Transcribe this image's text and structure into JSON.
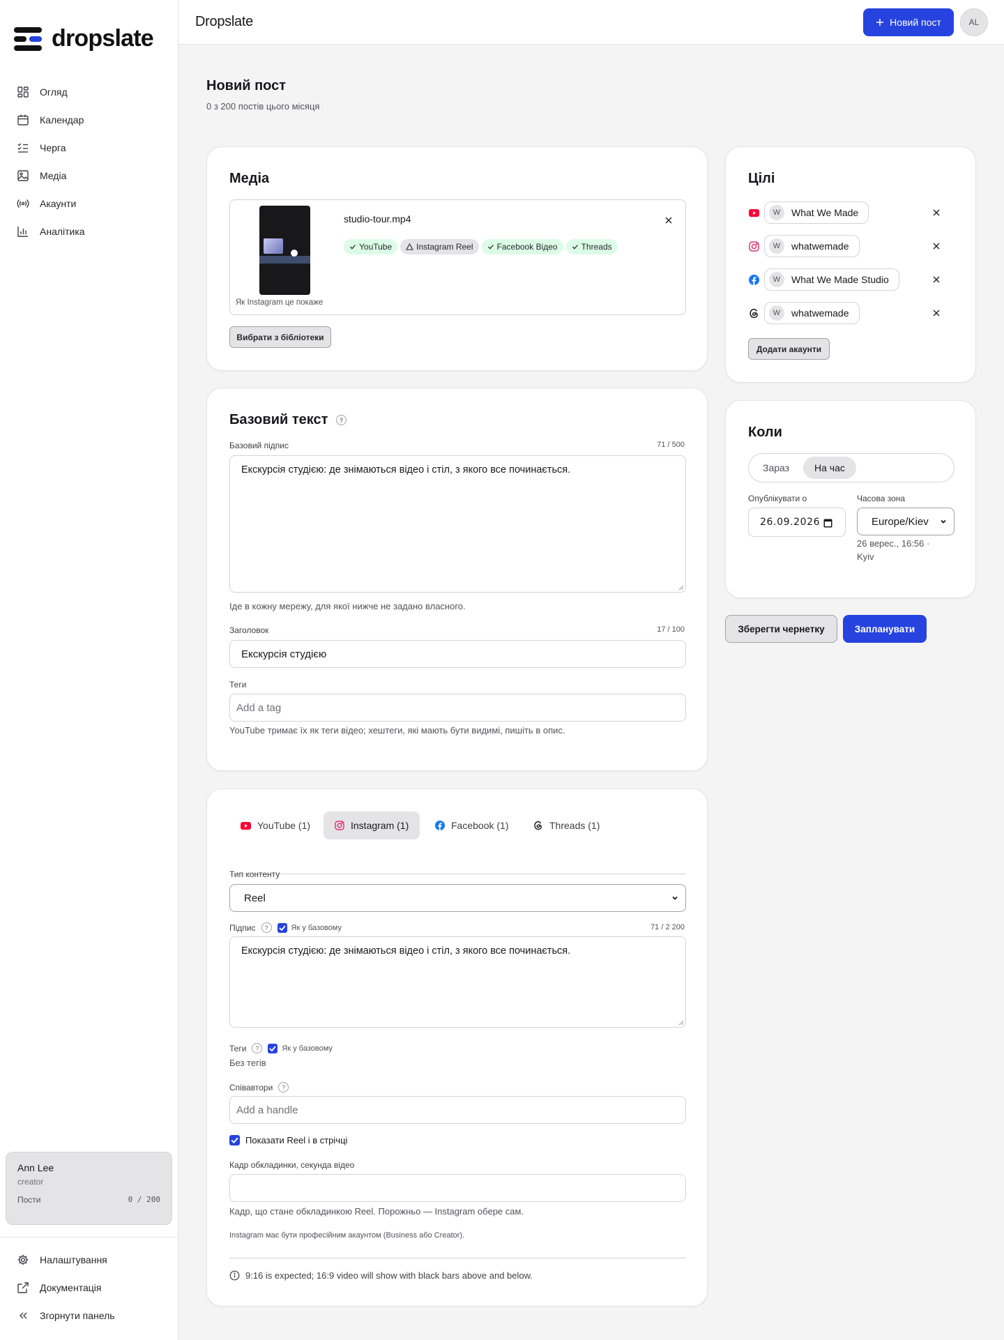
{
  "app": {
    "brand": "dropslate",
    "title": "Dropslate",
    "new_post_label": "Новий пост",
    "avatar_initials": "AL"
  },
  "sidebar": {
    "items": [
      {
        "label": "Огляд",
        "icon": "grid-icon"
      },
      {
        "label": "Календар",
        "icon": "calendar-icon"
      },
      {
        "label": "Черга",
        "icon": "list-check-icon"
      },
      {
        "label": "Медіа",
        "icon": "image-icon"
      },
      {
        "label": "Акаунти",
        "icon": "broadcast-icon"
      },
      {
        "label": "Аналітика",
        "icon": "bar-chart-icon"
      }
    ],
    "user": {
      "name": "Ann Lee",
      "role": "creator",
      "usage_label": "Пости",
      "usage_value": "0 / 200"
    },
    "bottom": [
      {
        "label": "Налаштування",
        "icon": "gear-icon"
      },
      {
        "label": "Документація",
        "icon": "external-link-icon"
      },
      {
        "label": "Згорнути панель",
        "icon": "chevrons-left-icon"
      }
    ]
  },
  "page": {
    "title": "Новий пост",
    "subtitle": "0 з 200 постів цього місяця"
  },
  "media": {
    "title": "Медіа",
    "filename": "studio-tour.mp4",
    "preview_caption": "Як Instagram це покаже",
    "platform_chips": [
      {
        "label": "YouTube",
        "status": "ok"
      },
      {
        "label": "Instagram Reel",
        "status": "warning"
      },
      {
        "label": "Facebook Відео",
        "status": "ok"
      },
      {
        "label": "Threads",
        "status": "ok"
      }
    ],
    "library_button": "Вибрати з бібліотеки"
  },
  "base_text": {
    "title": "Базовий текст",
    "help": "?",
    "caption_label": "Базовий підпис",
    "caption_counter": "71 / 500",
    "caption_value": "Екскурсія студією: де знімаються відео і стіл, з якого все починається.",
    "caption_hint": "Іде в кожну мережу, для якої нижче не задано власного.",
    "heading_label": "Заголовок",
    "heading_counter": "17 / 100",
    "heading_value": "Екскурсія студією",
    "tags_label": "Теги",
    "tags_placeholder": "Add a tag",
    "tags_hint": "YouTube тримає їх як теги відео; хештеги, які мають бути видимі, пишіть в опис."
  },
  "network": {
    "tabs": [
      {
        "label": "YouTube (1)",
        "icon": "youtube-icon",
        "active": false
      },
      {
        "label": "Instagram (1)",
        "icon": "instagram-icon",
        "active": true
      },
      {
        "label": "Facebook (1)",
        "icon": "facebook-icon",
        "active": false
      },
      {
        "label": "Threads (1)",
        "icon": "threads-icon",
        "active": false
      }
    ],
    "content_type_label": "Тип контенту",
    "content_type_value": "Reel",
    "caption_label": "Підпис",
    "same_as_base": "Як у базовому",
    "caption_counter": "71 / 2 200",
    "caption_value": "Екскурсія студією: де знімаються відео і стіл, з якого все починається.",
    "tags_label": "Теги",
    "tags_empty": "Без тегів",
    "collab_label": "Співавтори",
    "collab_placeholder": "Add a handle",
    "show_in_feed": "Показати Reel і в стрічці",
    "cover_label": "Кадр обкладинки, секунда відео",
    "cover_value": "",
    "cover_hint": "Кадр, що стане обкладинкою Reel. Порожньо — Instagram обере сам.",
    "account_note": "Instagram має бути професійним акаунтом (Business або Creator).",
    "aspect_note": "9:16 is expected; 16:9 video will show with black bars above and below."
  },
  "targets": {
    "title": "Цілі",
    "accounts": [
      {
        "platform": "youtube",
        "initial": "W",
        "name": "What We Made"
      },
      {
        "platform": "instagram",
        "initial": "W",
        "name": "whatwemade"
      },
      {
        "platform": "facebook",
        "initial": "W",
        "name": "What We Made Studio"
      },
      {
        "platform": "threads",
        "initial": "W",
        "name": "whatwemade"
      }
    ],
    "add_button": "Додати акаунти"
  },
  "when": {
    "title": "Коли",
    "mode_now": "Зараз",
    "mode_scheduled": "На час",
    "publish_label": "Опублікувати о",
    "date_value": "26.09.2026",
    "tz_label": "Часова зона",
    "tz_value": "Europe/Kiev",
    "local_preview": "26 верес., 16:56 · Kyiv"
  },
  "actions": {
    "save_draft": "Зберегти чернетку",
    "schedule": "Запланувати"
  },
  "colors": {
    "accent": "#2643e0",
    "youtube": "#ff0033",
    "instagram": "#e1306c",
    "facebook": "#1877f2",
    "ok_chip": "#dcfce7"
  }
}
